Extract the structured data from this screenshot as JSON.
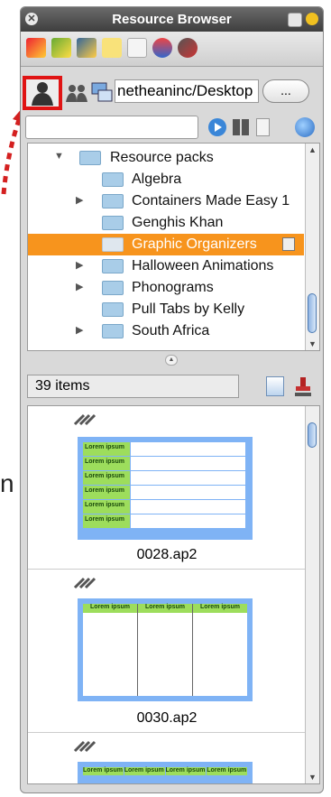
{
  "window": {
    "title": "Resource Browser"
  },
  "tabs": [
    "page-tab-icon",
    "images-tab-icon",
    "backgrounds-tab-icon",
    "notes-tab-icon",
    "documents-tab-icon",
    "spinner-tab-icon",
    "tools-tab-icon"
  ],
  "source": {
    "path": "netheaninc/Desktop",
    "browse_label": "..."
  },
  "tree": {
    "items": [
      {
        "label": "Resource packs",
        "expander": "▼",
        "level": 0
      },
      {
        "label": "Algebra",
        "expander": "",
        "level": 1
      },
      {
        "label": "Containers Made Easy 1",
        "expander": "▶",
        "level": 1
      },
      {
        "label": "Genghis Khan",
        "expander": "",
        "level": 1
      },
      {
        "label": "Graphic Organizers",
        "expander": "",
        "level": 1,
        "selected": true
      },
      {
        "label": "Halloween Animations",
        "expander": "▶",
        "level": 1
      },
      {
        "label": "Phonograms",
        "expander": "▶",
        "level": 1
      },
      {
        "label": "Pull Tabs by Kelly",
        "expander": "",
        "level": 1
      },
      {
        "label": "South Africa",
        "expander": "▶",
        "level": 1
      }
    ]
  },
  "status": {
    "count": "39 items"
  },
  "gallery": {
    "items": [
      {
        "filename": "0028.ap2",
        "thumb_text": "Lorem ipsum"
      },
      {
        "filename": "0030.ap2",
        "thumb_text": "Lorem ipsum"
      },
      {
        "filename": "",
        "thumb_text": "Lorem ipsum"
      }
    ]
  },
  "colors": {
    "selection": "#f7941d",
    "highlight_box": "#e01414",
    "arrow": "#d42020"
  }
}
